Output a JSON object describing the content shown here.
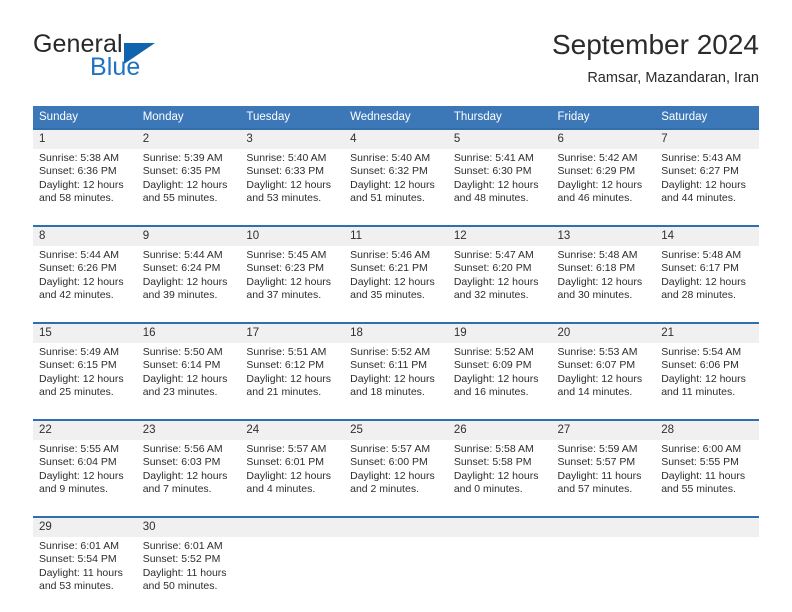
{
  "logo": {
    "word_one": "General",
    "word_two": "Blue",
    "triangle_icon": "blue-triangle-icon"
  },
  "header": {
    "title": "September 2024",
    "subtitle": "Ramsar, Mazandaran, Iran"
  },
  "colors": {
    "header_blue": "#3c77b8",
    "row_border_blue": "#2f6fae",
    "daynum_band": "#f0f0f0",
    "logo_blue": "#1f73c0",
    "text": "#2d2d2d"
  },
  "weekdays": [
    "Sunday",
    "Monday",
    "Tuesday",
    "Wednesday",
    "Thursday",
    "Friday",
    "Saturday"
  ],
  "weeks": [
    [
      {
        "day": "1",
        "sunrise": "Sunrise: 5:38 AM",
        "sunset": "Sunset: 6:36 PM",
        "daylight_1": "Daylight: 12 hours",
        "daylight_2": "and 58 minutes."
      },
      {
        "day": "2",
        "sunrise": "Sunrise: 5:39 AM",
        "sunset": "Sunset: 6:35 PM",
        "daylight_1": "Daylight: 12 hours",
        "daylight_2": "and 55 minutes."
      },
      {
        "day": "3",
        "sunrise": "Sunrise: 5:40 AM",
        "sunset": "Sunset: 6:33 PM",
        "daylight_1": "Daylight: 12 hours",
        "daylight_2": "and 53 minutes."
      },
      {
        "day": "4",
        "sunrise": "Sunrise: 5:40 AM",
        "sunset": "Sunset: 6:32 PM",
        "daylight_1": "Daylight: 12 hours",
        "daylight_2": "and 51 minutes."
      },
      {
        "day": "5",
        "sunrise": "Sunrise: 5:41 AM",
        "sunset": "Sunset: 6:30 PM",
        "daylight_1": "Daylight: 12 hours",
        "daylight_2": "and 48 minutes."
      },
      {
        "day": "6",
        "sunrise": "Sunrise: 5:42 AM",
        "sunset": "Sunset: 6:29 PM",
        "daylight_1": "Daylight: 12 hours",
        "daylight_2": "and 46 minutes."
      },
      {
        "day": "7",
        "sunrise": "Sunrise: 5:43 AM",
        "sunset": "Sunset: 6:27 PM",
        "daylight_1": "Daylight: 12 hours",
        "daylight_2": "and 44 minutes."
      }
    ],
    [
      {
        "day": "8",
        "sunrise": "Sunrise: 5:44 AM",
        "sunset": "Sunset: 6:26 PM",
        "daylight_1": "Daylight: 12 hours",
        "daylight_2": "and 42 minutes."
      },
      {
        "day": "9",
        "sunrise": "Sunrise: 5:44 AM",
        "sunset": "Sunset: 6:24 PM",
        "daylight_1": "Daylight: 12 hours",
        "daylight_2": "and 39 minutes."
      },
      {
        "day": "10",
        "sunrise": "Sunrise: 5:45 AM",
        "sunset": "Sunset: 6:23 PM",
        "daylight_1": "Daylight: 12 hours",
        "daylight_2": "and 37 minutes."
      },
      {
        "day": "11",
        "sunrise": "Sunrise: 5:46 AM",
        "sunset": "Sunset: 6:21 PM",
        "daylight_1": "Daylight: 12 hours",
        "daylight_2": "and 35 minutes."
      },
      {
        "day": "12",
        "sunrise": "Sunrise: 5:47 AM",
        "sunset": "Sunset: 6:20 PM",
        "daylight_1": "Daylight: 12 hours",
        "daylight_2": "and 32 minutes."
      },
      {
        "day": "13",
        "sunrise": "Sunrise: 5:48 AM",
        "sunset": "Sunset: 6:18 PM",
        "daylight_1": "Daylight: 12 hours",
        "daylight_2": "and 30 minutes."
      },
      {
        "day": "14",
        "sunrise": "Sunrise: 5:48 AM",
        "sunset": "Sunset: 6:17 PM",
        "daylight_1": "Daylight: 12 hours",
        "daylight_2": "and 28 minutes."
      }
    ],
    [
      {
        "day": "15",
        "sunrise": "Sunrise: 5:49 AM",
        "sunset": "Sunset: 6:15 PM",
        "daylight_1": "Daylight: 12 hours",
        "daylight_2": "and 25 minutes."
      },
      {
        "day": "16",
        "sunrise": "Sunrise: 5:50 AM",
        "sunset": "Sunset: 6:14 PM",
        "daylight_1": "Daylight: 12 hours",
        "daylight_2": "and 23 minutes."
      },
      {
        "day": "17",
        "sunrise": "Sunrise: 5:51 AM",
        "sunset": "Sunset: 6:12 PM",
        "daylight_1": "Daylight: 12 hours",
        "daylight_2": "and 21 minutes."
      },
      {
        "day": "18",
        "sunrise": "Sunrise: 5:52 AM",
        "sunset": "Sunset: 6:11 PM",
        "daylight_1": "Daylight: 12 hours",
        "daylight_2": "and 18 minutes."
      },
      {
        "day": "19",
        "sunrise": "Sunrise: 5:52 AM",
        "sunset": "Sunset: 6:09 PM",
        "daylight_1": "Daylight: 12 hours",
        "daylight_2": "and 16 minutes."
      },
      {
        "day": "20",
        "sunrise": "Sunrise: 5:53 AM",
        "sunset": "Sunset: 6:07 PM",
        "daylight_1": "Daylight: 12 hours",
        "daylight_2": "and 14 minutes."
      },
      {
        "day": "21",
        "sunrise": "Sunrise: 5:54 AM",
        "sunset": "Sunset: 6:06 PM",
        "daylight_1": "Daylight: 12 hours",
        "daylight_2": "and 11 minutes."
      }
    ],
    [
      {
        "day": "22",
        "sunrise": "Sunrise: 5:55 AM",
        "sunset": "Sunset: 6:04 PM",
        "daylight_1": "Daylight: 12 hours",
        "daylight_2": "and 9 minutes."
      },
      {
        "day": "23",
        "sunrise": "Sunrise: 5:56 AM",
        "sunset": "Sunset: 6:03 PM",
        "daylight_1": "Daylight: 12 hours",
        "daylight_2": "and 7 minutes."
      },
      {
        "day": "24",
        "sunrise": "Sunrise: 5:57 AM",
        "sunset": "Sunset: 6:01 PM",
        "daylight_1": "Daylight: 12 hours",
        "daylight_2": "and 4 minutes."
      },
      {
        "day": "25",
        "sunrise": "Sunrise: 5:57 AM",
        "sunset": "Sunset: 6:00 PM",
        "daylight_1": "Daylight: 12 hours",
        "daylight_2": "and 2 minutes."
      },
      {
        "day": "26",
        "sunrise": "Sunrise: 5:58 AM",
        "sunset": "Sunset: 5:58 PM",
        "daylight_1": "Daylight: 12 hours",
        "daylight_2": "and 0 minutes."
      },
      {
        "day": "27",
        "sunrise": "Sunrise: 5:59 AM",
        "sunset": "Sunset: 5:57 PM",
        "daylight_1": "Daylight: 11 hours",
        "daylight_2": "and 57 minutes."
      },
      {
        "day": "28",
        "sunrise": "Sunrise: 6:00 AM",
        "sunset": "Sunset: 5:55 PM",
        "daylight_1": "Daylight: 11 hours",
        "daylight_2": "and 55 minutes."
      }
    ],
    [
      {
        "day": "29",
        "sunrise": "Sunrise: 6:01 AM",
        "sunset": "Sunset: 5:54 PM",
        "daylight_1": "Daylight: 11 hours",
        "daylight_2": "and 53 minutes."
      },
      {
        "day": "30",
        "sunrise": "Sunrise: 6:01 AM",
        "sunset": "Sunset: 5:52 PM",
        "daylight_1": "Daylight: 11 hours",
        "daylight_2": "and 50 minutes."
      },
      {
        "day": "",
        "sunrise": "",
        "sunset": "",
        "daylight_1": "",
        "daylight_2": ""
      },
      {
        "day": "",
        "sunrise": "",
        "sunset": "",
        "daylight_1": "",
        "daylight_2": ""
      },
      {
        "day": "",
        "sunrise": "",
        "sunset": "",
        "daylight_1": "",
        "daylight_2": ""
      },
      {
        "day": "",
        "sunrise": "",
        "sunset": "",
        "daylight_1": "",
        "daylight_2": ""
      },
      {
        "day": "",
        "sunrise": "",
        "sunset": "",
        "daylight_1": "",
        "daylight_2": ""
      }
    ]
  ]
}
